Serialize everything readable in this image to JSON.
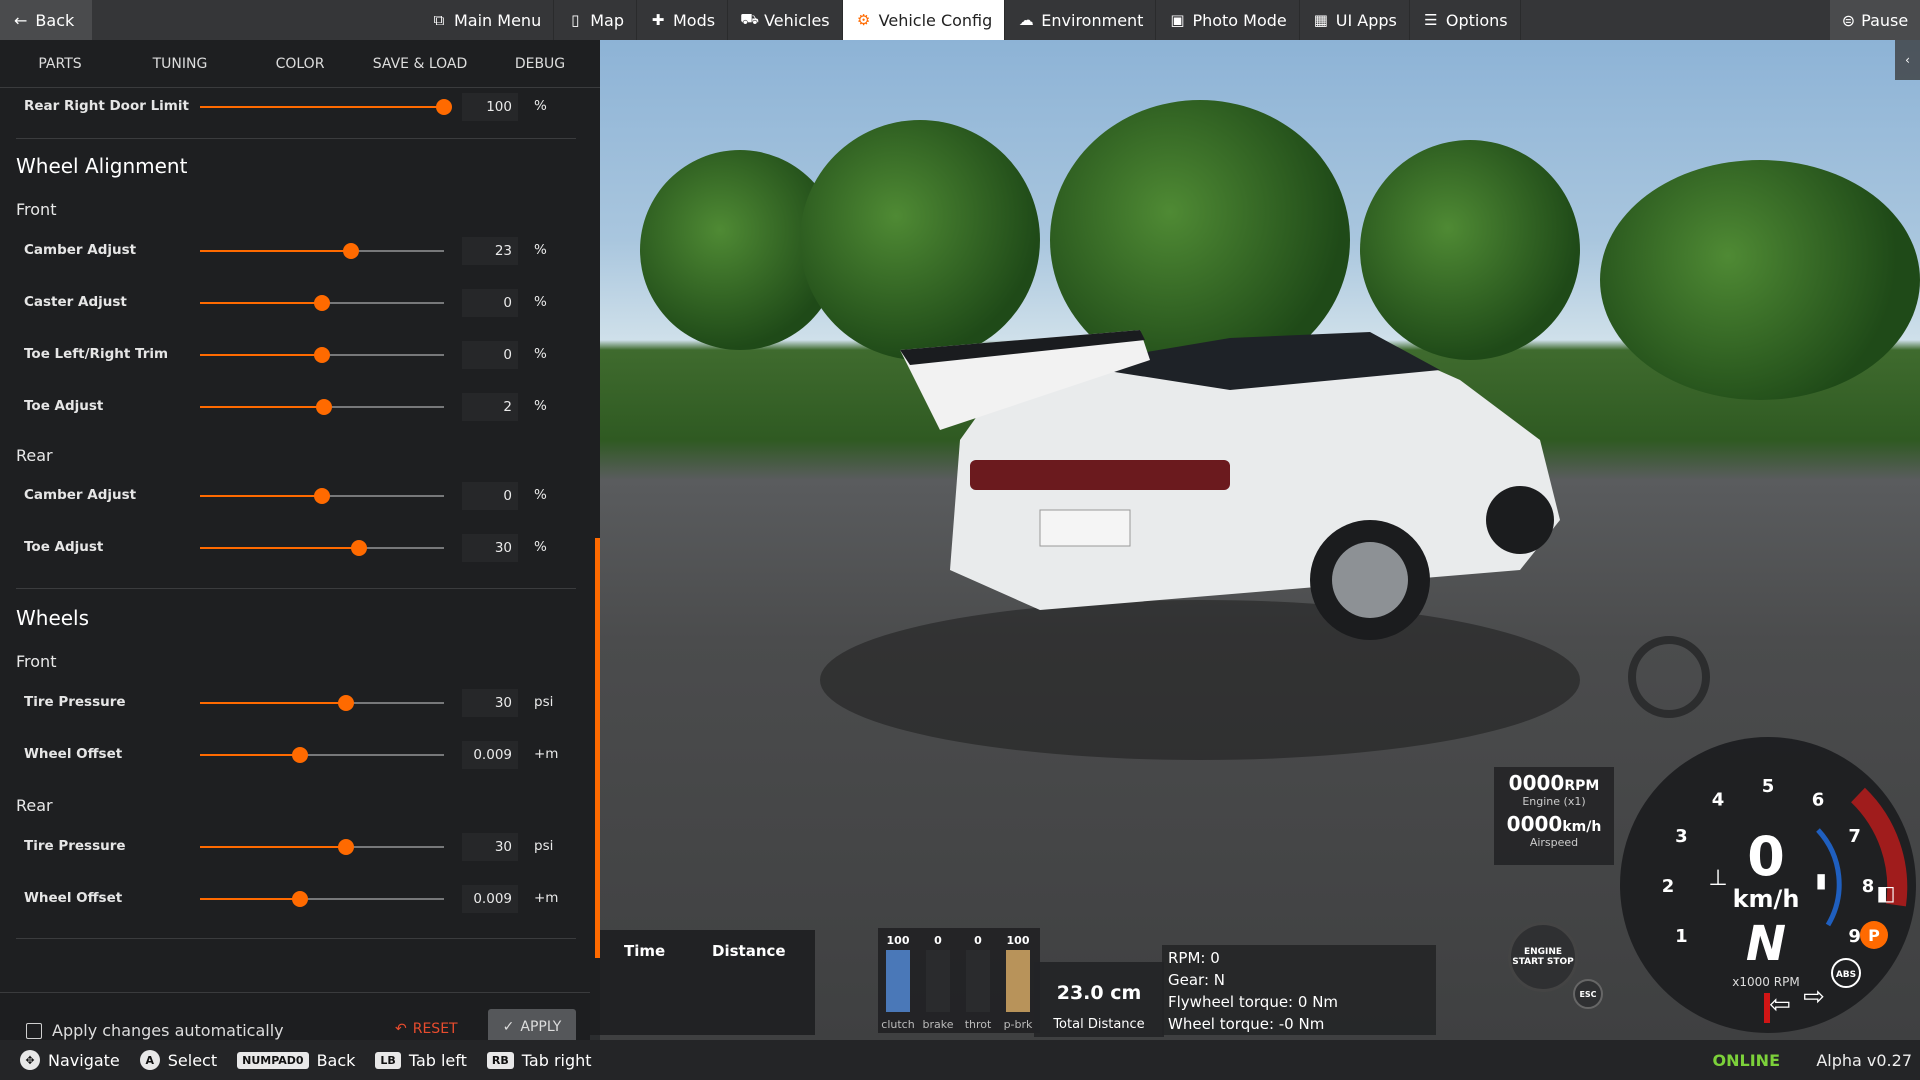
{
  "topbar": {
    "back_label": "Back",
    "pause_label": "Pause",
    "menu": [
      {
        "label": "Main Menu",
        "icon": "main-menu-icon",
        "glyph": "⧉"
      },
      {
        "label": "Map",
        "icon": "map-icon",
        "glyph": "▯"
      },
      {
        "label": "Mods",
        "icon": "puzzle-icon",
        "glyph": "✚"
      },
      {
        "label": "Vehicles",
        "icon": "car-icon",
        "glyph": "⛟"
      },
      {
        "label": "Vehicle Config",
        "icon": "engine-icon",
        "glyph": "⚙",
        "active": true
      },
      {
        "label": "Environment",
        "icon": "weather-icon",
        "glyph": "☁"
      },
      {
        "label": "Photo Mode",
        "icon": "camera-icon",
        "glyph": "▣"
      },
      {
        "label": "UI Apps",
        "icon": "apps-icon",
        "glyph": "▦"
      },
      {
        "label": "Options",
        "icon": "sliders-icon",
        "glyph": "☰"
      }
    ]
  },
  "panel": {
    "tabs": [
      "PARTS",
      "TUNING",
      "COLOR",
      "SAVE & LOAD",
      "DEBUG"
    ],
    "top_row": {
      "label": "Rear Right Door Limit",
      "value": "100",
      "unit": "%",
      "fraction": 1.0
    },
    "wheel_alignment": {
      "title": "Wheel Alignment",
      "front_label": "Front",
      "front": [
        {
          "label": "Camber Adjust",
          "value": "23",
          "unit": "%",
          "fraction": 0.62
        },
        {
          "label": "Caster Adjust",
          "value": "0",
          "unit": "%",
          "fraction": 0.5
        },
        {
          "label": "Toe Left/Right Trim",
          "value": "0",
          "unit": "%",
          "fraction": 0.5
        },
        {
          "label": "Toe Adjust",
          "value": "2",
          "unit": "%",
          "fraction": 0.51
        }
      ],
      "rear_label": "Rear",
      "rear": [
        {
          "label": "Camber Adjust",
          "value": "0",
          "unit": "%",
          "fraction": 0.5
        },
        {
          "label": "Toe Adjust",
          "value": "30",
          "unit": "%",
          "fraction": 0.65
        }
      ]
    },
    "wheels": {
      "title": "Wheels",
      "front_label": "Front",
      "front": [
        {
          "label": "Tire Pressure",
          "value": "30",
          "unit": "psi",
          "fraction": 0.6
        },
        {
          "label": "Wheel Offset",
          "value": "0.009",
          "unit": "+m",
          "fraction": 0.41
        }
      ],
      "rear_label": "Rear",
      "rear": [
        {
          "label": "Tire Pressure",
          "value": "30",
          "unit": "psi",
          "fraction": 0.6
        },
        {
          "label": "Wheel Offset",
          "value": "0.009",
          "unit": "+m",
          "fraction": 0.41
        }
      ]
    },
    "footer": {
      "apply_auto_label": "Apply changes automatically",
      "reset_label": "RESET",
      "apply_label": "APPLY"
    }
  },
  "bottombar": {
    "items": [
      {
        "key": "✥",
        "label": "Navigate"
      },
      {
        "key": "A",
        "label": "Select"
      },
      {
        "key": "NUMPAD0",
        "label": "Back"
      },
      {
        "key": "LB",
        "label": "Tab left"
      },
      {
        "key": "RB",
        "label": "Tab right"
      }
    ],
    "status": "ONLINE",
    "version": "Alpha v0.27"
  },
  "hud": {
    "time_label": "Time",
    "distance_label": "Distance",
    "pedals": [
      {
        "value": "100",
        "label": "clutch",
        "color": "#4a78b8",
        "level": 1.0
      },
      {
        "value": "0",
        "label": "brake",
        "color": "#b84a4a",
        "level": 0
      },
      {
        "value": "0",
        "label": "throt",
        "color": "#4ab86a",
        "level": 0
      },
      {
        "value": "100",
        "label": "p-brk",
        "color": "#b8935a",
        "level": 1.0
      }
    ],
    "total_distance_value": "23.0 cm",
    "total_distance_label": "Total Distance",
    "engine_lines": [
      "RPM: 0",
      "Gear: N",
      "Flywheel torque: 0 Nm",
      "Wheel torque: -0 Nm"
    ],
    "rpm_value": "0000",
    "rpm_unit": "RPM",
    "rpm_sub": "Engine (x1)",
    "speed_value": "0000",
    "speed_unit": "km/h",
    "speed_sub": "Airspeed",
    "gauge": {
      "speed": "0",
      "unit": "km/h",
      "gear": "N",
      "scale_label": "x1000 RPM",
      "ticks": [
        "1",
        "2",
        "3",
        "4",
        "5",
        "6",
        "7",
        "8",
        "9"
      ]
    },
    "start_stop_label": "ENGINE START STOP",
    "esc_label": "ESC",
    "abs_label": "ABS",
    "park_label": "P"
  },
  "colors": {
    "accent": "#ff6a00",
    "online": "#7cd13a"
  }
}
